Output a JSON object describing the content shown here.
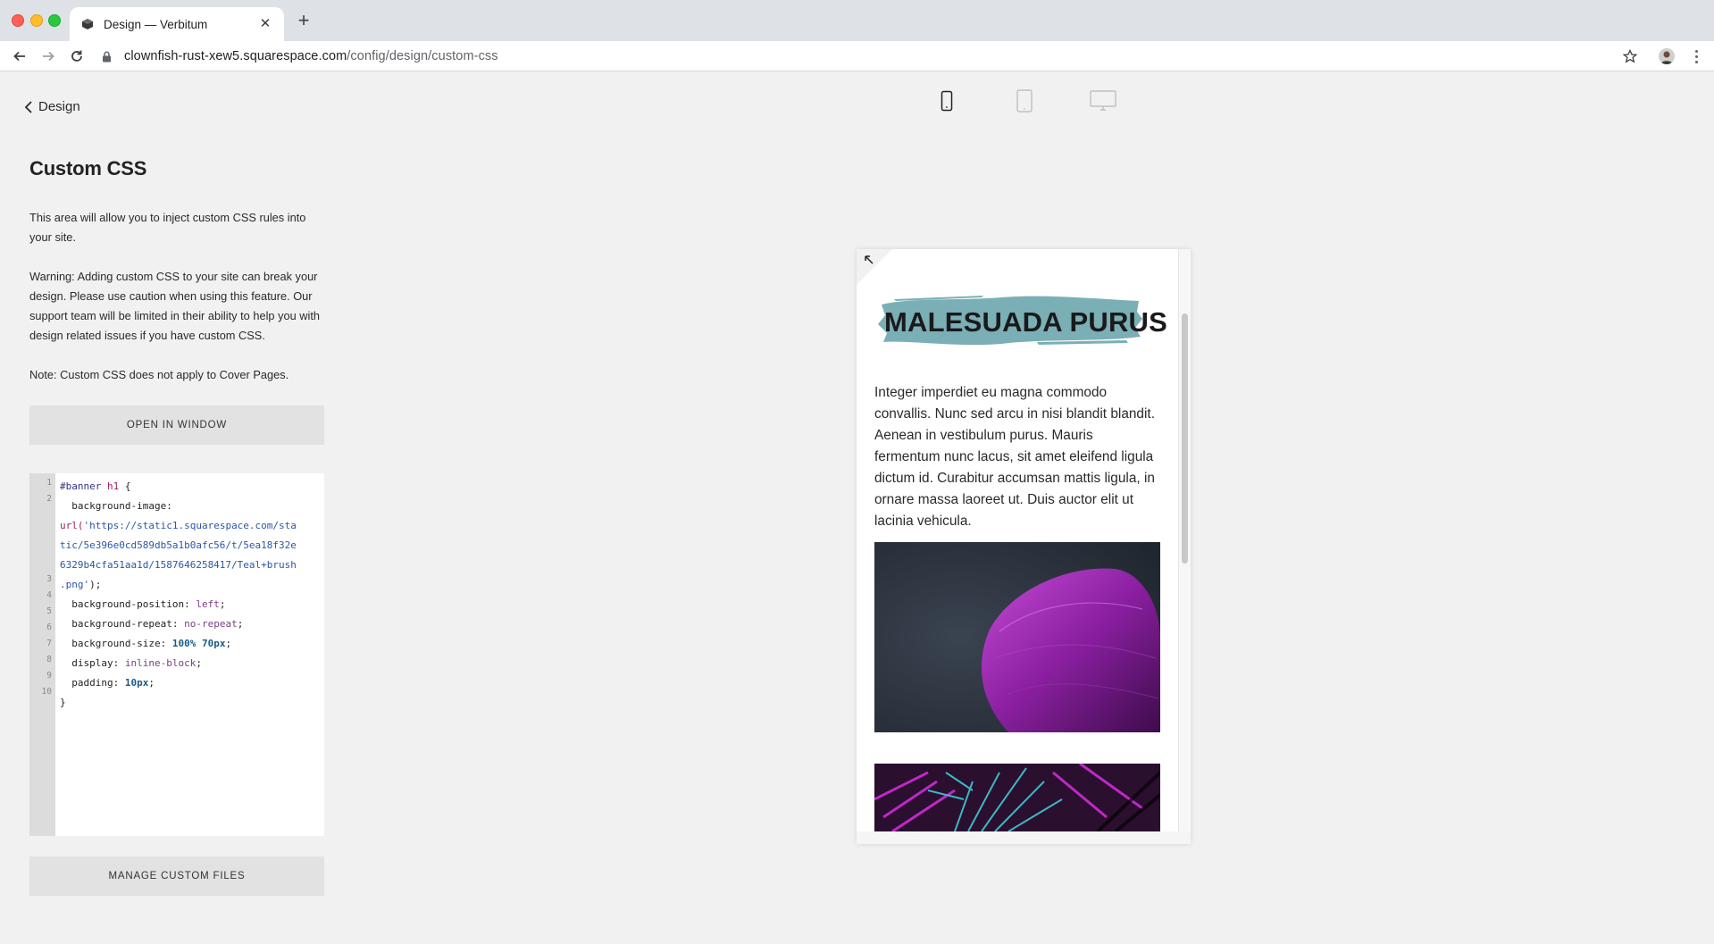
{
  "browser": {
    "tab_title": "Design — Verbitum",
    "new_tab_label": "+",
    "tab_close_label": "✕",
    "url_host": "clownfish-rust-xew5.squarespace.com",
    "url_path": "/config/design/custom-css"
  },
  "panel": {
    "back_label": "Design",
    "title": "Custom CSS",
    "desc1": "This area will allow you to inject custom CSS rules into your site.",
    "desc2": "Warning: Adding custom CSS to your site can break your design. Please use caution when using this feature. Our support team will be limited in their ability to help you with design related issues if you have custom CSS.",
    "desc3": "Note: Custom CSS does not apply to Cover Pages.",
    "open_button": "OPEN IN WINDOW",
    "manage_button": "MANAGE CUSTOM FILES"
  },
  "editor": {
    "line_numbers": [
      "1",
      "2",
      "3",
      "4",
      "5",
      "6",
      "7",
      "8",
      "9",
      "10"
    ],
    "code": {
      "l1_sel": "#banner",
      "l1_tag": "h1",
      "l1_brace": "{",
      "l2_prop": "background-image:",
      "l2_fn": "url(",
      "l2_str_a": "'https://static1.squarespace.com/sta",
      "l2_str_b": "tic/5e396e0cd589db5a1b0afc56/t/5ea18f32e",
      "l2_str_c": "6329b4cfa51aa1d/1587646258417/Teal+brush",
      "l2_str_d": ".png'",
      "l2_end": ");",
      "l3_prop": "background-position:",
      "l3_val": "left",
      "l4_prop": "background-repeat:",
      "l4_val": "no-repeat",
      "l5_prop": "background-size:",
      "l5_val": "100% 70px",
      "l6_prop": "display:",
      "l6_val": "inline-block",
      "l7_prop": "padding:",
      "l7_val": "10px",
      "l8": "}",
      "semi": ";"
    }
  },
  "preview": {
    "heading": "MALESUADA PURUS",
    "body": "Integer imperdiet eu magna commodo convallis. Nunc sed arcu in nisi blandit blandit. Aenean in vestibulum purus. Mauris fermentum nunc lacus, sit amet eleifend ligula dictum id. Curabitur accumsan mattis ligula, in ornare massa laoreet ut. Duis auctor elit ut lacinia vehicula.",
    "brush_color": "#7aafb6",
    "device_modes": [
      "mobile",
      "tablet",
      "desktop"
    ],
    "active_device": "mobile"
  }
}
